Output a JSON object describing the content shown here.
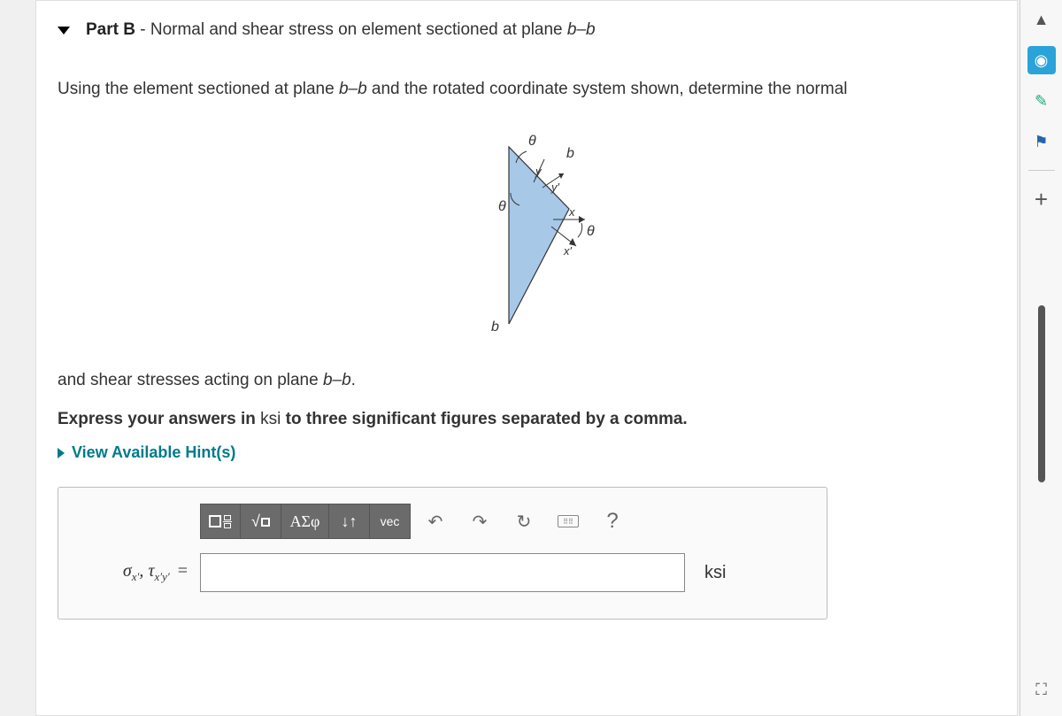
{
  "part": {
    "label": "Part B",
    "separator": " - ",
    "title": "Normal and shear stress on element sectioned at plane ",
    "plane": "b–b"
  },
  "text": {
    "segment1_a": "Using the element sectioned at plane ",
    "segment1_b": " and the rotated coordinate system shown, determine the normal",
    "segment2_a": "and shear stresses acting on plane ",
    "segment2_b": "."
  },
  "diagram": {
    "theta": "θ",
    "b": "b",
    "x": "x",
    "y": "y",
    "xprime": "x′",
    "yprime": "y′"
  },
  "instruction": {
    "pre": "Express your answers in ",
    "unit": "ksi",
    "post": " to three significant figures separated by a comma."
  },
  "hints": {
    "label": "View Available Hint(s)"
  },
  "toolbar": {
    "templates": "▭",
    "sqrt": "√▭",
    "greek": "ΑΣφ",
    "subsup": "↓↑",
    "vec": "vec",
    "undo": "↶",
    "redo": "↷",
    "reset": "↻",
    "keyboard": "⌨",
    "help": "?"
  },
  "answer": {
    "label_sigma": "σ",
    "label_sub_sigma": "x′",
    "label_sep": ", ",
    "label_tau": "τ",
    "label_sub_tau": "x′y′",
    "equals": "=",
    "value": "",
    "unit": "ksi"
  },
  "rail": {
    "up": "▲",
    "camera": "◉",
    "paint": "✎",
    "flag": "⚑",
    "plus": "+",
    "fullscreen": "⛶"
  }
}
